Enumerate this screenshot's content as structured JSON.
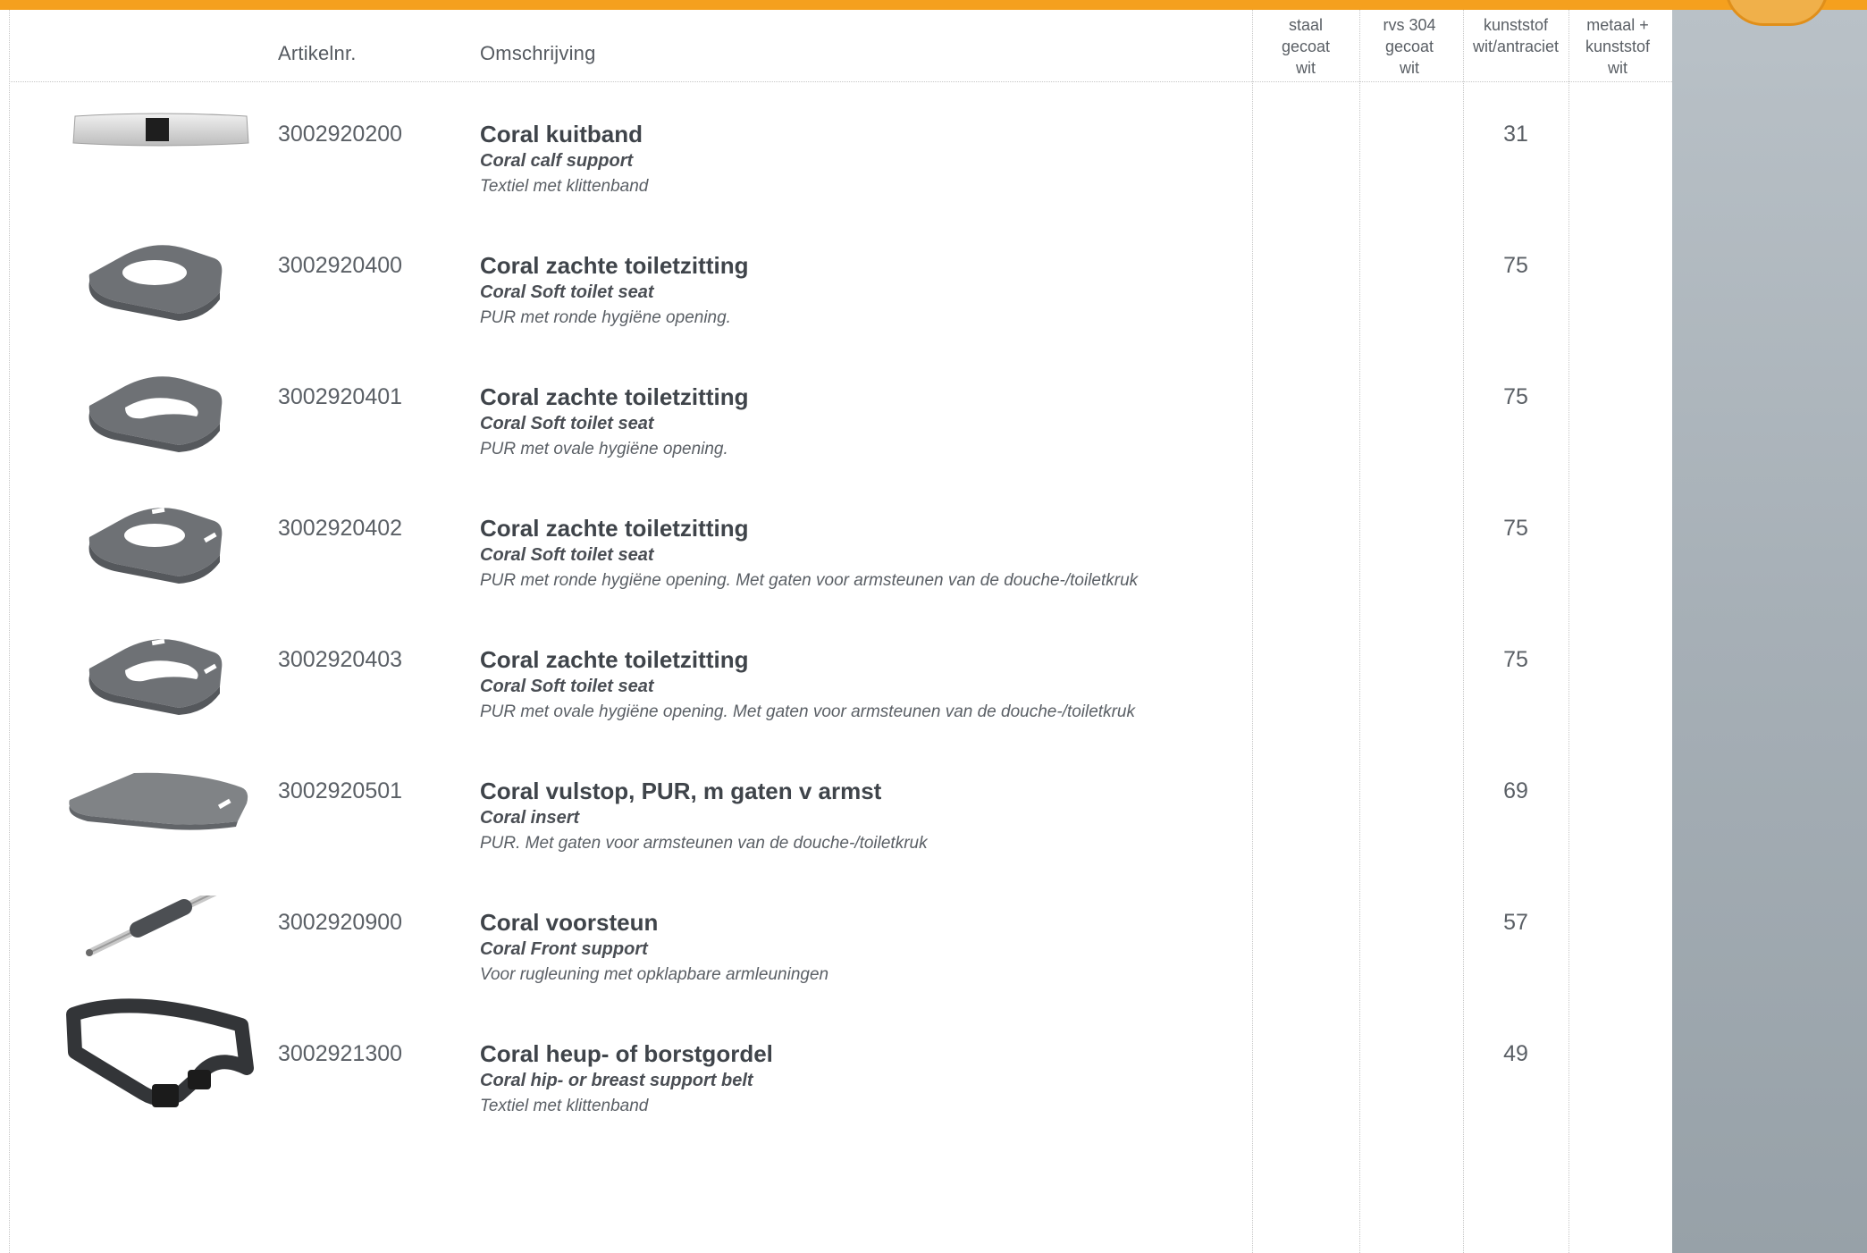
{
  "header": {
    "col_artikelnr": "Artikelnr.",
    "col_omschrijving": "Omschrijving",
    "price_cols": [
      "staal\ngecoat\nwit",
      "rvs 304\ngecoat\nwit",
      "kunststof\nwit/antraciet",
      "metaal +\nkunststof\nwit"
    ]
  },
  "colors": {
    "accent": "#f5a01e",
    "side_panel": "#a6afb6",
    "product_gray": "#6e7175"
  },
  "rows": [
    {
      "artnr": "3002920200",
      "title": "Coral kuitband",
      "subtitle": "Coral calf support",
      "note": "Textiel met klittenband",
      "price": "31",
      "icon": "calf-band-image"
    },
    {
      "artnr": "3002920400",
      "title": "Coral zachte toiletzitting",
      "subtitle": "Coral Soft toilet seat",
      "note": "PUR met ronde hygiëne opening.",
      "price": "75",
      "icon": "toilet-seat-round-image"
    },
    {
      "artnr": "3002920401",
      "title": "Coral zachte toiletzitting",
      "subtitle": "Coral Soft toilet seat",
      "note": "PUR met ovale hygiëne opening.",
      "price": "75",
      "icon": "toilet-seat-oval-image"
    },
    {
      "artnr": "3002920402",
      "title": "Coral zachte toiletzitting",
      "subtitle": "Coral Soft toilet seat",
      "note": "PUR met ronde hygiëne opening. Met gaten voor armsteunen van de douche-/toiletkruk",
      "price": "75",
      "icon": "toilet-seat-round-holes-image"
    },
    {
      "artnr": "3002920403",
      "title": "Coral zachte toiletzitting",
      "subtitle": "Coral Soft toilet seat",
      "note": "PUR met ovale hygiëne opening. Met gaten voor armsteunen van de douche-/toiletkruk",
      "price": "75",
      "icon": "toilet-seat-oval-holes-image"
    },
    {
      "artnr": "3002920501",
      "title": "Coral vulstop, PUR, m gaten v armst",
      "subtitle": "Coral insert",
      "note": "PUR. Met gaten voor armsteunen van de douche-/toiletkruk",
      "price": "69",
      "icon": "insert-pad-image"
    },
    {
      "artnr": "3002920900",
      "title": "Coral voorsteun",
      "subtitle": "Coral Front support",
      "note": "Voor rugleuning met opklapbare armleuningen",
      "price": "57",
      "icon": "front-support-bar-image"
    },
    {
      "artnr": "3002921300",
      "title": "Coral heup- of borstgordel",
      "subtitle": "Coral hip- or breast support belt",
      "note": "Textiel met klittenband",
      "price": "49",
      "icon": "support-belt-image"
    }
  ]
}
